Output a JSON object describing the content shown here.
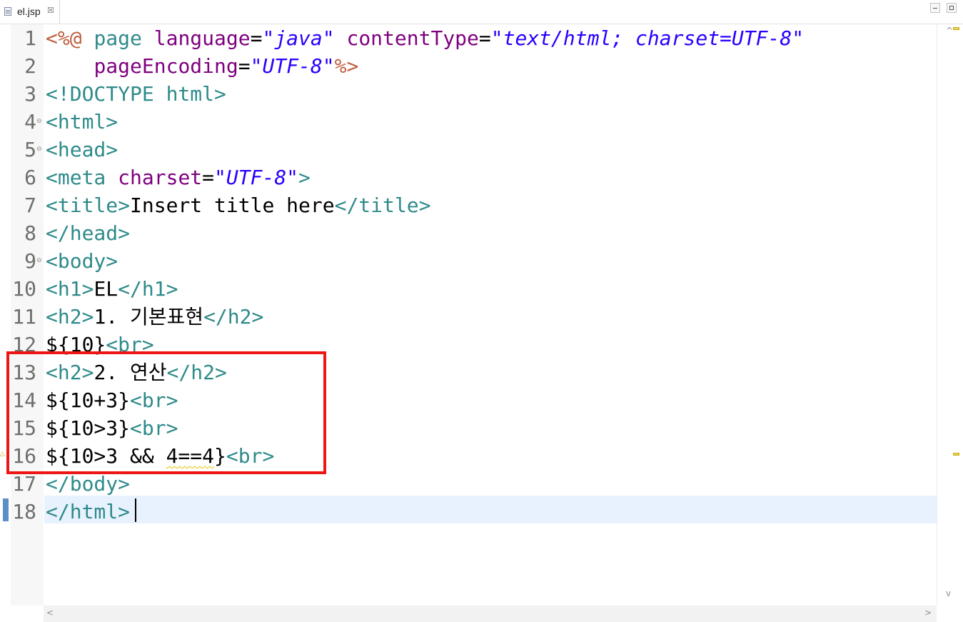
{
  "tab": {
    "label": "el.jsp",
    "close": "☒"
  },
  "window": {
    "minimize": "minimize",
    "maximize": "maximize"
  },
  "icons": {
    "file": "jsp-file-icon",
    "fold": "⊖",
    "warning": "△"
  },
  "colors": {
    "directive": "#bf5f3f",
    "attribute": "#7f007f",
    "string": "#2a00ff",
    "tag": "#2f8a8a",
    "text": "#000000",
    "highlight": "#ee1515",
    "current_line": "#e8f2fe"
  },
  "editor": {
    "current_line": 18,
    "line_numbers": [
      "1",
      "2",
      "3",
      "4",
      "5",
      "6",
      "7",
      "8",
      "9",
      "10",
      "11",
      "12",
      "13",
      "14",
      "15",
      "16",
      "17",
      "18"
    ],
    "folds": {
      "4": "⊖",
      "5": "⊖",
      "9": "⊖"
    },
    "lines": [
      [
        {
          "c": "t-directive",
          "t": "<%@"
        },
        {
          "c": "t-text",
          "t": " "
        },
        {
          "c": "t-tag",
          "t": "page"
        },
        {
          "c": "t-text",
          "t": " "
        },
        {
          "c": "t-attr",
          "t": "language"
        },
        {
          "c": "t-text",
          "t": "="
        },
        {
          "c": "t-str",
          "t": "\"java\""
        },
        {
          "c": "t-text",
          "t": " "
        },
        {
          "c": "t-attr",
          "t": "contentType"
        },
        {
          "c": "t-text",
          "t": "="
        },
        {
          "c": "t-str",
          "t": "\"text/html; charset=UTF-8\""
        }
      ],
      [
        {
          "c": "t-text",
          "t": "    "
        },
        {
          "c": "t-attr",
          "t": "pageEncoding"
        },
        {
          "c": "t-text",
          "t": "="
        },
        {
          "c": "t-str",
          "t": "\"UTF-8\""
        },
        {
          "c": "t-directive",
          "t": "%>"
        }
      ],
      [
        {
          "c": "t-tag",
          "t": "<!DOCTYPE html>"
        }
      ],
      [
        {
          "c": "t-tag",
          "t": "<html>"
        }
      ],
      [
        {
          "c": "t-tag",
          "t": "<head>"
        }
      ],
      [
        {
          "c": "t-tag",
          "t": "<meta"
        },
        {
          "c": "t-text",
          "t": " "
        },
        {
          "c": "t-attr",
          "t": "charset"
        },
        {
          "c": "t-text",
          "t": "="
        },
        {
          "c": "t-str",
          "t": "\"UTF-8\""
        },
        {
          "c": "t-tag",
          "t": ">"
        }
      ],
      [
        {
          "c": "t-tag",
          "t": "<title>"
        },
        {
          "c": "t-text",
          "t": "Insert title here"
        },
        {
          "c": "t-tag",
          "t": "</title>"
        }
      ],
      [
        {
          "c": "t-tag",
          "t": "</head>"
        }
      ],
      [
        {
          "c": "t-tag",
          "t": "<body>"
        }
      ],
      [
        {
          "c": "t-tag",
          "t": "<h1>"
        },
        {
          "c": "t-text",
          "t": "EL"
        },
        {
          "c": "t-tag",
          "t": "</h1>"
        }
      ],
      [
        {
          "c": "t-tag",
          "t": "<h2>"
        },
        {
          "c": "t-text",
          "t": "1. 기본표현"
        },
        {
          "c": "t-tag",
          "t": "</h2>"
        }
      ],
      [
        {
          "c": "t-text",
          "t": "${10}"
        },
        {
          "c": "t-tag",
          "t": "<br>"
        }
      ],
      [
        {
          "c": "t-tag",
          "t": "<h2>"
        },
        {
          "c": "t-text",
          "t": "2. 연산"
        },
        {
          "c": "t-tag",
          "t": "</h2>"
        }
      ],
      [
        {
          "c": "t-text",
          "t": "${10+3}"
        },
        {
          "c": "t-tag",
          "t": "<br>"
        }
      ],
      [
        {
          "c": "t-text",
          "t": "${10>3}"
        },
        {
          "c": "t-tag",
          "t": "<br>"
        }
      ],
      [
        {
          "c": "t-text",
          "t": "${10>3 && "
        },
        {
          "c": "t-text t-warn",
          "t": "4==4"
        },
        {
          "c": "t-text",
          "t": "}"
        },
        {
          "c": "t-tag",
          "t": "<br>"
        }
      ],
      [
        {
          "c": "t-tag",
          "t": "</body>"
        }
      ],
      [
        {
          "c": "t-tag",
          "t": "</html>"
        }
      ]
    ]
  },
  "scroll": {
    "left": "<",
    "right": ">",
    "up": "^",
    "down": "v"
  }
}
